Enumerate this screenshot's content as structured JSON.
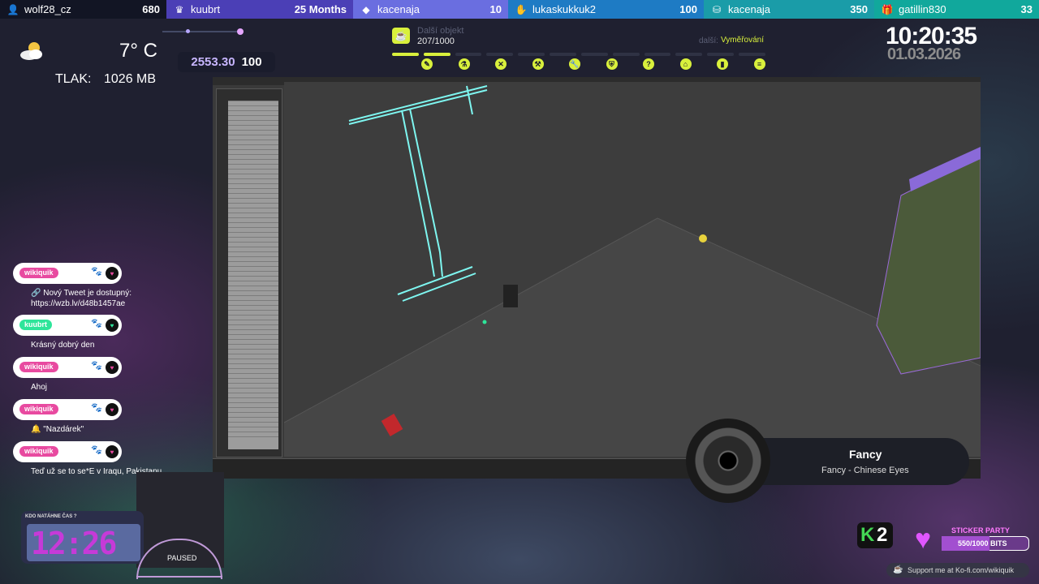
{
  "colors": {
    "accent_lime": "#d9f03c",
    "accent_pink": "#e84aa0",
    "accent_green": "#2ee59a",
    "accent_purple": "#e056ff"
  },
  "leaderboard": [
    {
      "icon": "user-plus-icon",
      "name": "wolf28_cz",
      "value": "680",
      "bg": "#121524"
    },
    {
      "icon": "crown-icon",
      "name": "kuubrt",
      "value": "25 Months",
      "bg": "#4b3fb6"
    },
    {
      "icon": "diamond-icon",
      "name": "kacenaja",
      "value": "10",
      "bg": "#6a6ee0"
    },
    {
      "icon": "hand-icon",
      "name": "lukaskukkuk2",
      "value": "100",
      "bg": "#1e7bc4"
    },
    {
      "icon": "coins-icon",
      "name": "kacenaja",
      "value": "350",
      "bg": "#1a9ca8"
    },
    {
      "icon": "gift-icon",
      "name": "gatillin830",
      "value": "33",
      "bg": "#11a89c"
    }
  ],
  "weather": {
    "icon": "partly-cloudy-icon",
    "temperature": "7° C",
    "pressure_label": "TLAK:",
    "pressure_value": "1026 MB"
  },
  "score": {
    "value": "2553.30",
    "max": "100"
  },
  "goal": {
    "title": "Další objekt",
    "count": "207/1000",
    "task_label": "další:",
    "task": "Vyměřování",
    "progress": 0.207,
    "icons": [
      "pencil-icon",
      "flask-icon",
      "close-icon",
      "hammer-icon",
      "wrench-icon",
      "shield-icon",
      "question-icon",
      "house-icon",
      "bookmark-icon",
      "layers-icon"
    ]
  },
  "clock": {
    "time": "10:20:35",
    "date": "01.03.2026"
  },
  "chat": [
    {
      "user": "wikiquik",
      "user_color": "#e84aa0",
      "text": "🔗 Nový Tweet je dostupný:",
      "text2": "https://wzb.lv/d48b1457ae"
    },
    {
      "user": "kuubrt",
      "user_color": "#2ee59a",
      "text": "Krásný dobrý den",
      "text2": ""
    },
    {
      "user": "wikiquik",
      "user_color": "#e84aa0",
      "text": "Ahoj",
      "text2": ""
    },
    {
      "user": "wikiquik",
      "user_color": "#e84aa0",
      "text": "🔔 \"Nazdárek\"",
      "text2": ""
    },
    {
      "user": "wikiquik",
      "user_color": "#e84aa0",
      "text": "Teď už se to se*E v Iraqu, Pakistanu",
      "text2": ""
    }
  ],
  "timer": {
    "label": "KDO NATÁHNE ČAS ?",
    "digits": "12:26"
  },
  "paused": {
    "label": "PAUSED"
  },
  "now_playing": {
    "title": "Fancy",
    "artist": "Fancy - Chinese Eyes"
  },
  "k2": {
    "k": "K",
    "two": "2"
  },
  "sticker_party": {
    "title": "STICKER PARTY",
    "bits": "550/1000 BITS",
    "progress": 0.55
  },
  "kofi": {
    "text": "Support me at Ko-fi.com/wikiquik"
  }
}
